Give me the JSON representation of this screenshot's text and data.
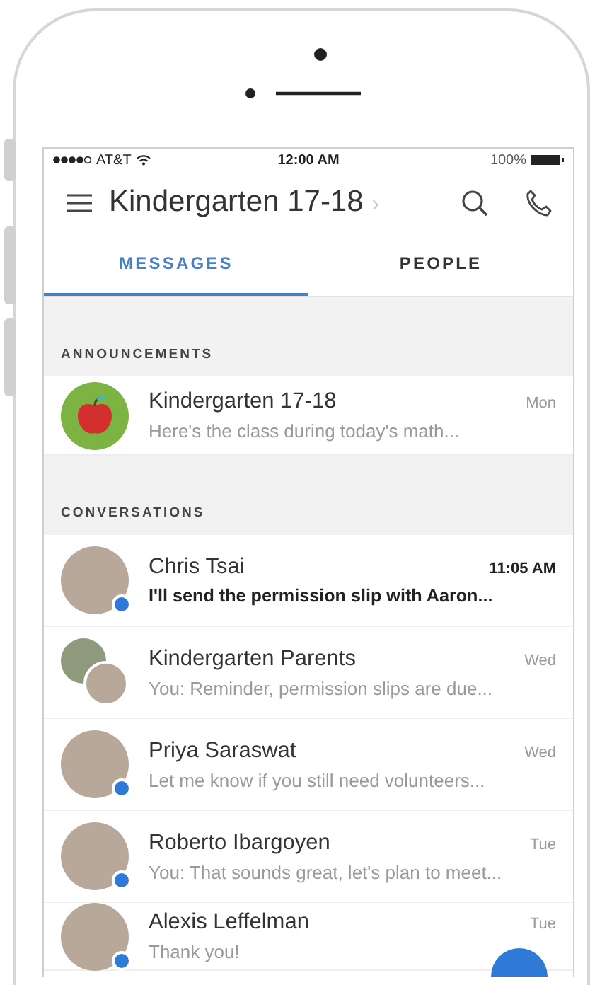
{
  "status_bar": {
    "carrier": "AT&T",
    "time": "12:00 AM",
    "battery": "100%"
  },
  "header": {
    "title": "Kindergarten 17-18",
    "chevron": "›"
  },
  "tabs": [
    {
      "label": "MESSAGES",
      "selected": true
    },
    {
      "label": "PEOPLE",
      "selected": false
    }
  ],
  "sections": [
    {
      "title": "ANNOUNCEMENTS",
      "items": [
        {
          "name": "Kindergarten 17-18",
          "preview": "Here's the class during today's math...",
          "time": "Mon",
          "unread": false,
          "kind": "apple",
          "badge": false
        }
      ]
    },
    {
      "title": "CONVERSATIONS",
      "items": [
        {
          "name": "Chris Tsai",
          "preview": "I'll send the permission slip with Aaron...",
          "time": "11:05 AM",
          "unread": true,
          "kind": "person",
          "badge": true
        },
        {
          "name": "Kindergarten Parents",
          "preview": "You: Reminder, permission slips are due...",
          "time": "Wed",
          "unread": false,
          "kind": "group",
          "badge": false
        },
        {
          "name": "Priya Saraswat",
          "preview": "Let me know if you still need volunteers...",
          "time": "Wed",
          "unread": false,
          "kind": "person",
          "badge": true
        },
        {
          "name": "Roberto Ibargoyen",
          "preview": "You: That sounds great, let's plan to meet...",
          "time": "Tue",
          "unread": false,
          "kind": "person",
          "badge": true
        },
        {
          "name": "Alexis Leffelman",
          "preview": "Thank you!",
          "time": "Tue",
          "unread": false,
          "kind": "person",
          "badge": true
        }
      ]
    }
  ]
}
